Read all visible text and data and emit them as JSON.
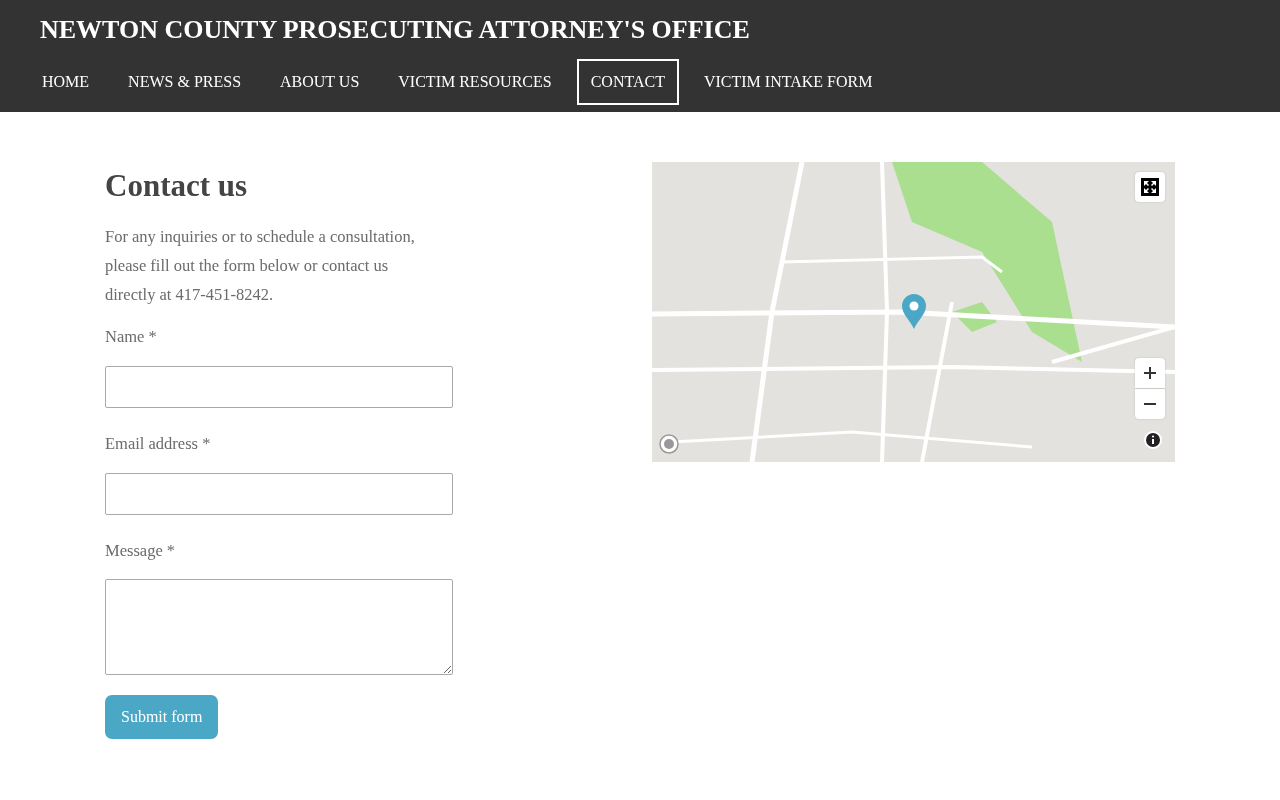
{
  "site_title": "NEWTON COUNTY PROSECUTING ATTORNEY'S OFFICE",
  "nav": [
    {
      "label": "HOME",
      "selected": false
    },
    {
      "label": "NEWS & PRESS",
      "selected": false
    },
    {
      "label": "ABOUT US",
      "selected": false
    },
    {
      "label": "VICTIM RESOURCES",
      "selected": false
    },
    {
      "label": "CONTACT",
      "selected": true
    },
    {
      "label": "VICTIM INTAKE FORM",
      "selected": false
    }
  ],
  "heading": "Contact us",
  "intro": "For any inquiries or to schedule a consultation, please fill out the form below or contact us directly at 417-451-8242.",
  "fields": [
    {
      "label": "Name *",
      "kind": "text"
    },
    {
      "label": "Email address *",
      "kind": "email"
    },
    {
      "label": "Message *",
      "kind": "textarea"
    }
  ],
  "submit": "Submit form"
}
